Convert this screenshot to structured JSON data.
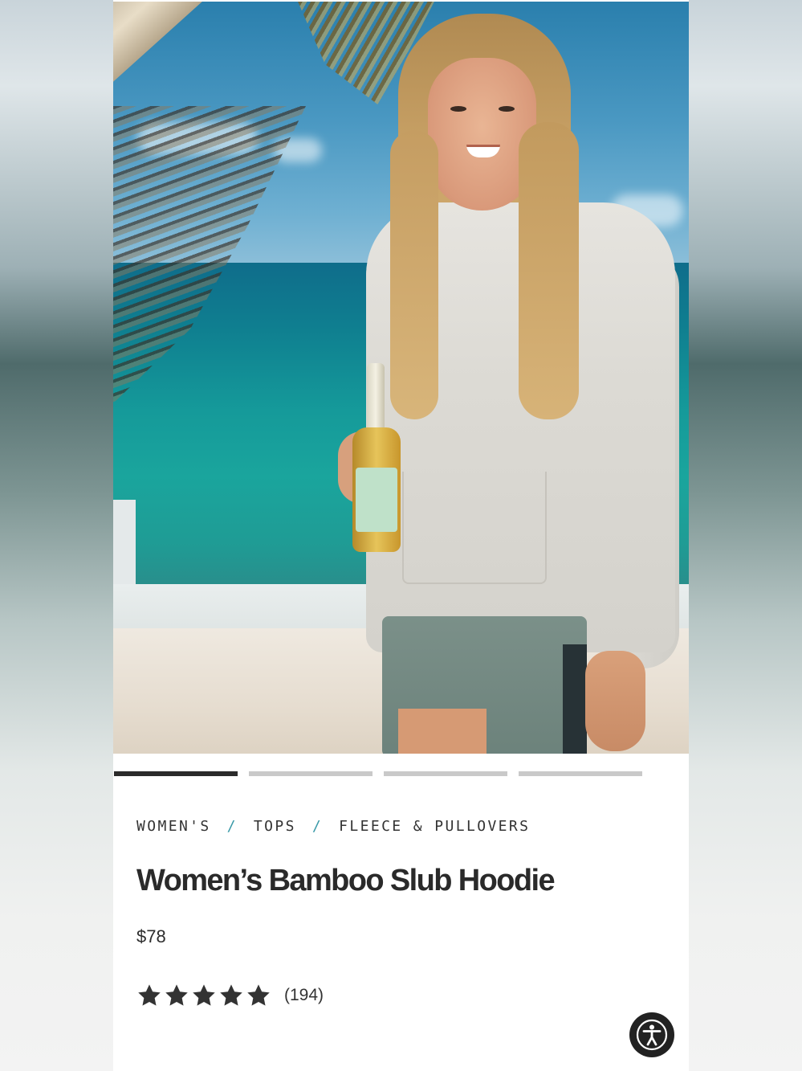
{
  "product": {
    "breadcrumb": [
      "WOMEN'S",
      "TOPS",
      "FLEECE & PULLOVERS"
    ],
    "breadcrumb_separator": "/",
    "title": "Women’s Bamboo Slub Hoodie",
    "price": "$78",
    "rating": 5,
    "review_count": "(194)"
  },
  "carousel": {
    "slide_count": 4,
    "active_index": 0
  },
  "icons": {
    "star": "star-icon",
    "accessibility": "accessibility-icon"
  },
  "colors": {
    "separator_accent": "#3a9aa8",
    "indicator_active": "#2b2b2b",
    "indicator_inactive": "#c9c9c9",
    "star": "#333333"
  }
}
